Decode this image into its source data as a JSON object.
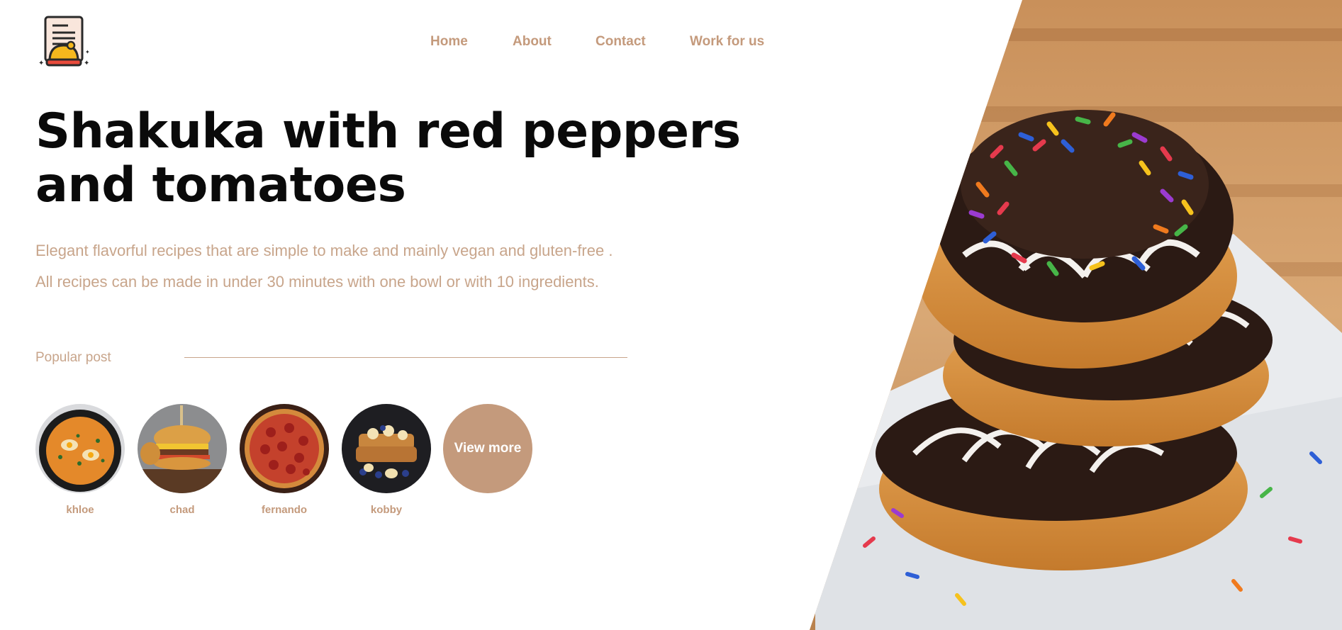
{
  "nav": {
    "items": [
      {
        "label": "Home"
      },
      {
        "label": "About"
      },
      {
        "label": "Contact"
      },
      {
        "label": "Work for us"
      }
    ]
  },
  "hero": {
    "title": "Shakuka with red peppers and tomatoes",
    "lead_1": "Elegant flavorful recipes that are simple to make and mainly vegan and gluten-free .",
    "lead_2": "All recipes can be made in under 30 minutes with one bowl or with 10 ingredients."
  },
  "popular": {
    "label": "Popular post",
    "posts": [
      {
        "name": "khloe",
        "image": "shakshuka-pan"
      },
      {
        "name": "chad",
        "image": "burger"
      },
      {
        "name": "fernando",
        "image": "pepperoni-pizza"
      },
      {
        "name": "kobby",
        "image": "french-toast"
      }
    ],
    "view_more": "View more"
  },
  "colors": {
    "accent": "#c49a7c",
    "muted_text": "#c8a58b",
    "heading": "#0a0a0a"
  }
}
